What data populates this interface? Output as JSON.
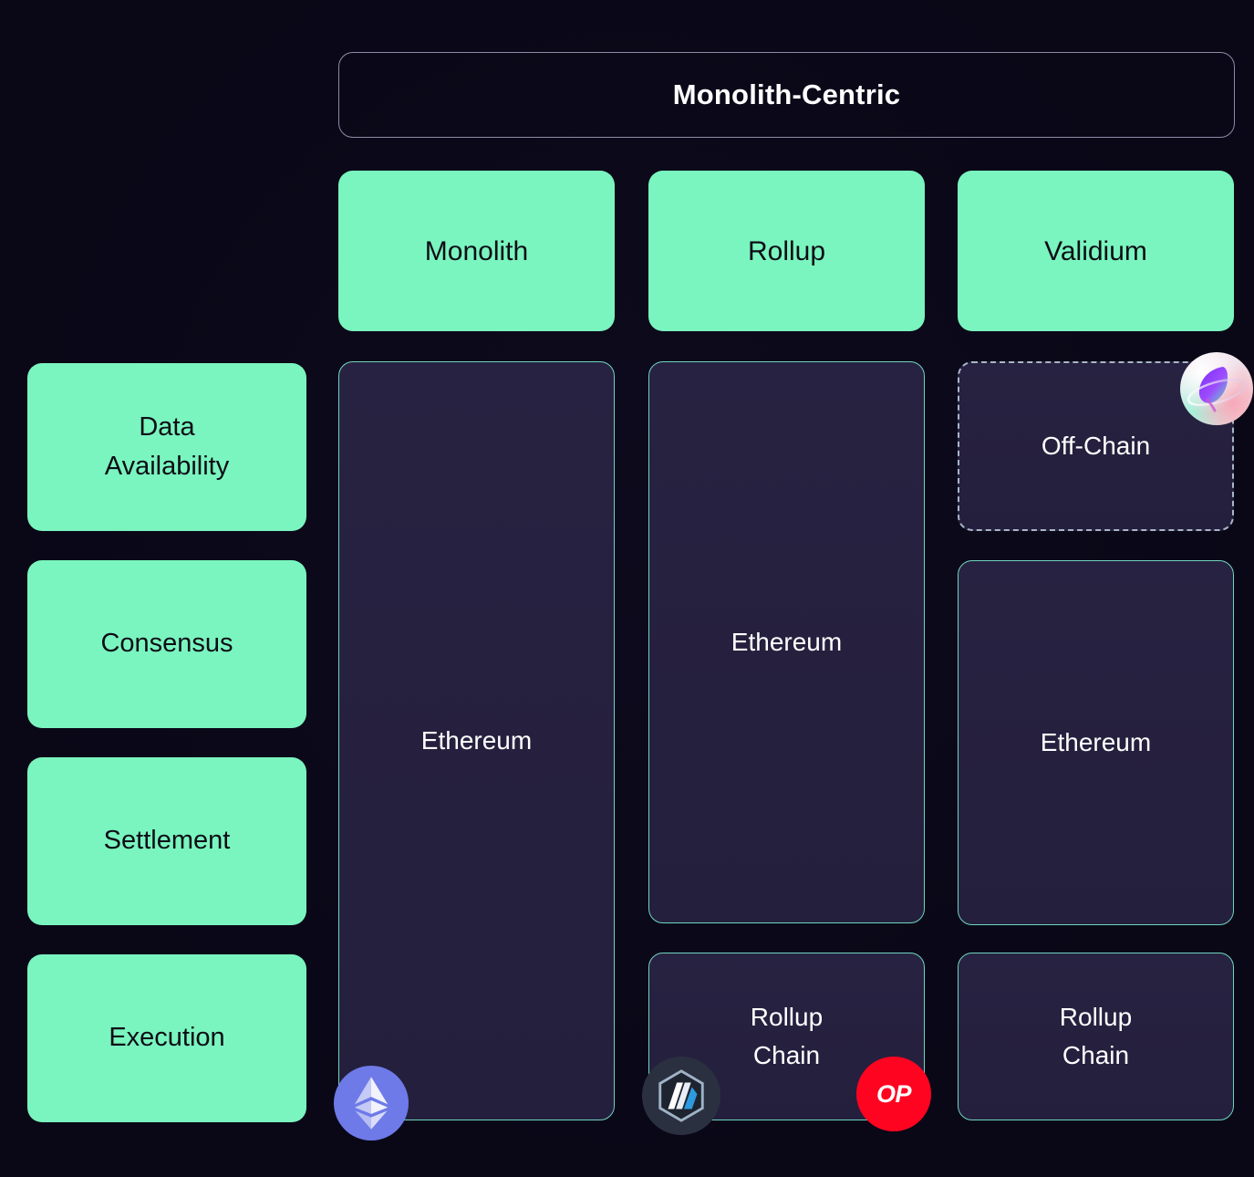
{
  "banner": {
    "title": "Monolith-Centric"
  },
  "colors": {
    "background": "#0a0817",
    "mint": "#7af5bf",
    "cell_fill": "#272241",
    "cell_border": "#6fd5c0",
    "banner_border": "#8d8aa6",
    "ethereum_badge": "#6e7ae8",
    "arbitrum_badge": "#2b3040",
    "optimism_badge": "#ff0420"
  },
  "columns": [
    {
      "label": "Monolith"
    },
    {
      "label": "Rollup"
    },
    {
      "label": "Validium"
    }
  ],
  "rows": [
    {
      "label_line1": "Data",
      "label_line2": "Availability"
    },
    {
      "label_line1": "Consensus",
      "label_line2": ""
    },
    {
      "label_line1": "Settlement",
      "label_line2": ""
    },
    {
      "label_line1": "Execution",
      "label_line2": ""
    }
  ],
  "cells": {
    "monolith_all": {
      "line1": "Ethereum",
      "line2": ""
    },
    "rollup_da_consensus_settlement": {
      "line1": "Ethereum",
      "line2": ""
    },
    "rollup_execution": {
      "line1": "Rollup",
      "line2": "Chain"
    },
    "validium_da": {
      "line1": "Off-Chain",
      "line2": ""
    },
    "validium_consensus_settlement": {
      "line1": "Ethereum",
      "line2": ""
    },
    "validium_execution": {
      "line1": "Rollup",
      "line2": "Chain"
    }
  },
  "badges": {
    "ethereum": {
      "name": "ethereum-logo",
      "text": ""
    },
    "arbitrum": {
      "name": "arbitrum-logo",
      "text": ""
    },
    "optimism": {
      "name": "optimism-logo",
      "text": "OP"
    },
    "celestia": {
      "name": "celestia-logo",
      "text": ""
    }
  }
}
